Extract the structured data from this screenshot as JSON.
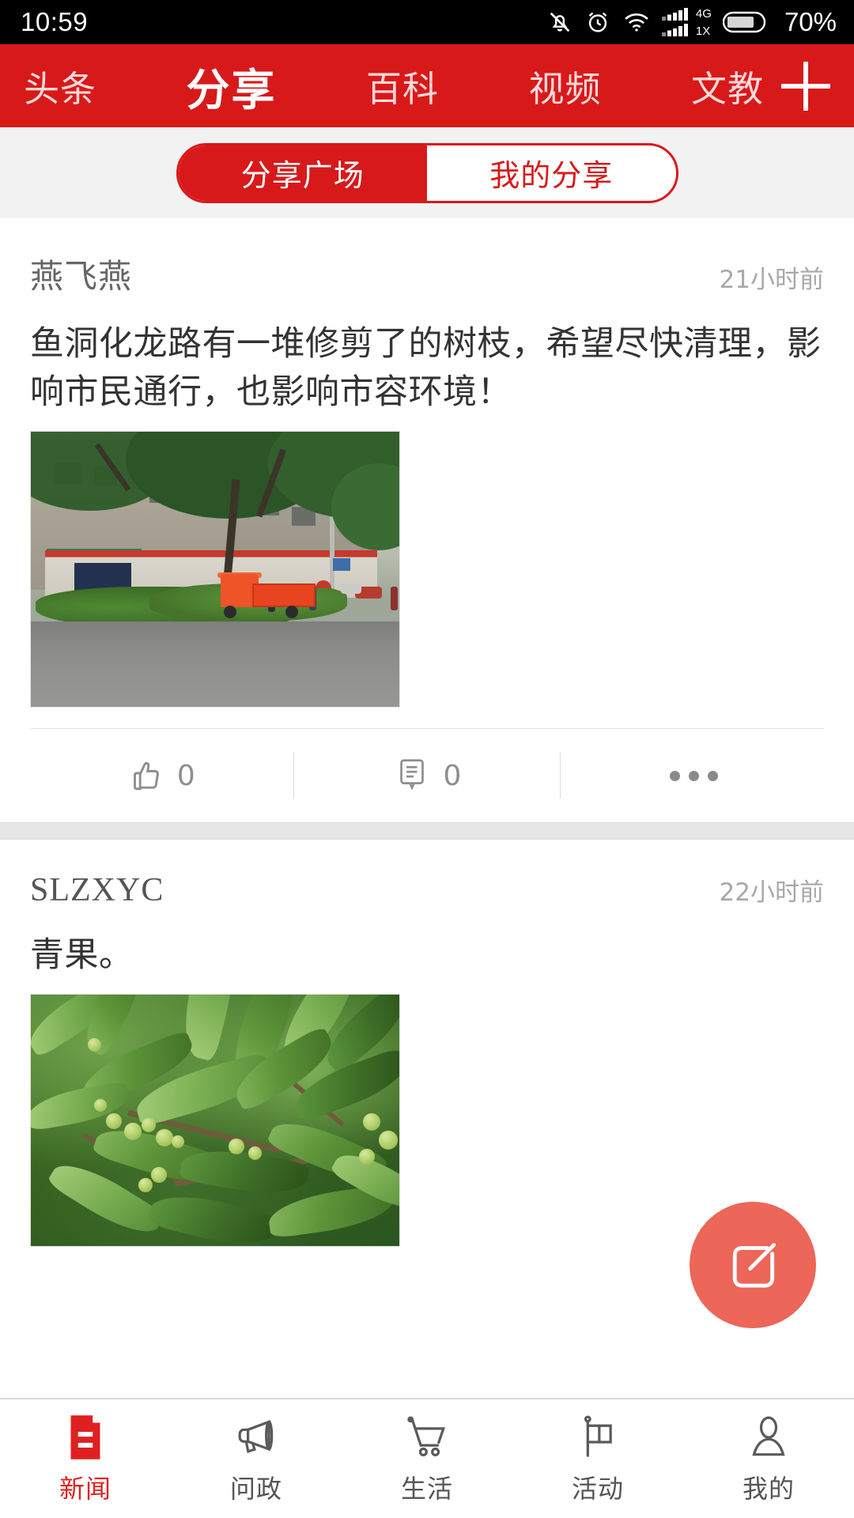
{
  "status_bar": {
    "time": "10:59",
    "battery_percent": "70%",
    "network_primary": "4G",
    "network_secondary": "1X",
    "icons": [
      "mute-icon",
      "alarm-icon",
      "wifi-icon",
      "cellular-signal-icon",
      "battery-icon"
    ]
  },
  "top_nav": {
    "tabs": [
      {
        "label": "头条",
        "active": false
      },
      {
        "label": "分享",
        "active": true
      },
      {
        "label": "百科",
        "active": false
      },
      {
        "label": "视频",
        "active": false
      },
      {
        "label": "文教",
        "active": false
      }
    ],
    "add_button": "plus-icon",
    "background_color": "#d8191a"
  },
  "segmented_control": {
    "items": [
      {
        "label": "分享广场",
        "active": true
      },
      {
        "label": "我的分享",
        "active": false
      }
    ],
    "accent_color": "#d8191a"
  },
  "feed": {
    "posts": [
      {
        "author": "燕飞燕",
        "time": "21小时前",
        "text": "鱼洞化龙路有一堆修剪了的树枝，希望尽快清理，影响市民通行，也影响市容环境！",
        "image_alt": "街道上堆放的修剪树枝与橙色三轮货车",
        "like_count": "0",
        "comment_count": "0",
        "more_icon": "more-dots-icon"
      },
      {
        "author": "SLZXYC",
        "time": "22小时前",
        "text": "青果。",
        "image_alt": "绿叶与青色果实的特写"
      }
    ]
  },
  "compose_fab": {
    "icon": "compose-edit-icon",
    "color": "#ec6659"
  },
  "bottom_nav": {
    "items": [
      {
        "label": "新闻",
        "icon": "news-document-icon",
        "active": true
      },
      {
        "label": "问政",
        "icon": "megaphone-icon",
        "active": false
      },
      {
        "label": "生活",
        "icon": "shopping-cart-icon",
        "active": false
      },
      {
        "label": "活动",
        "icon": "flag-icon",
        "active": false
      },
      {
        "label": "我的",
        "icon": "person-icon",
        "active": false
      }
    ],
    "active_color": "#e02020"
  }
}
